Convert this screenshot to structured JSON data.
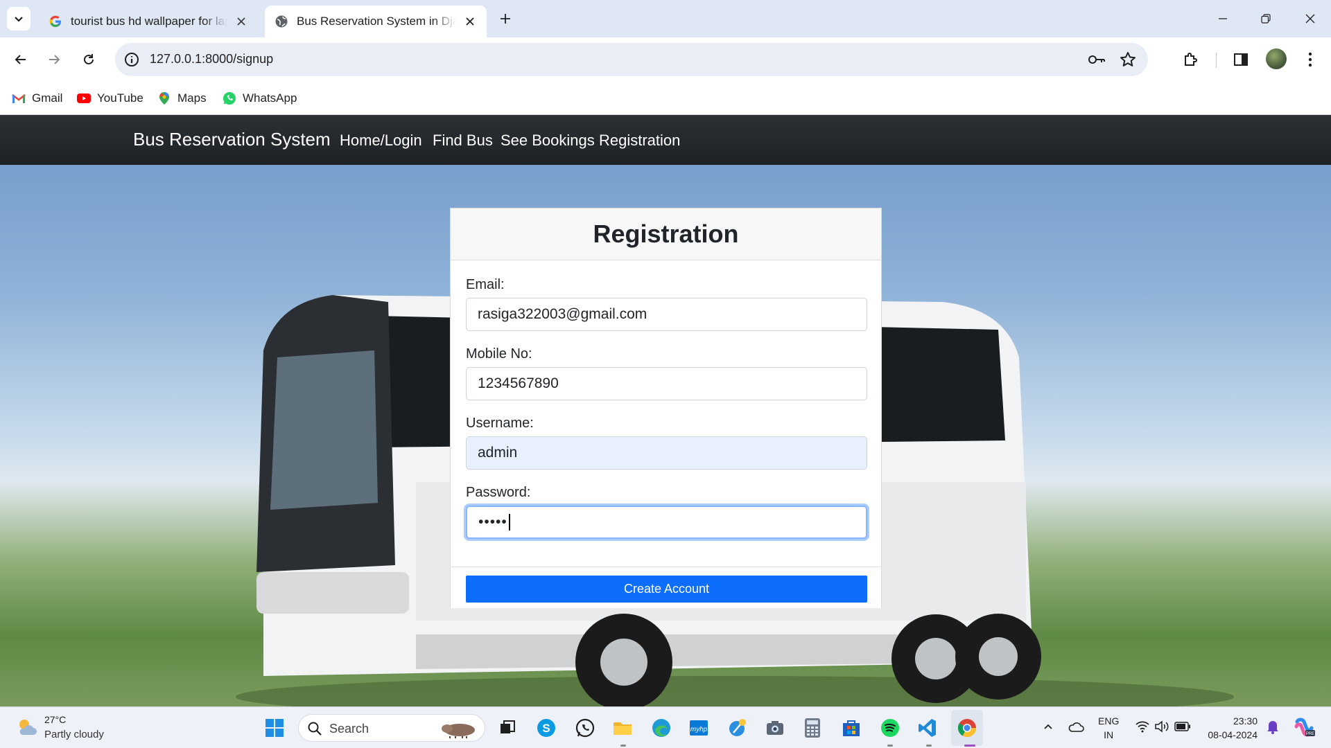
{
  "browser": {
    "tabs": [
      {
        "title": "tourist bus hd wallpaper for lap",
        "active": false
      },
      {
        "title": "Bus Reservation System in Djan",
        "active": true
      }
    ],
    "url": "127.0.0.1:8000/signup",
    "bookmarks": [
      "Gmail",
      "YouTube",
      "Maps",
      "WhatsApp"
    ]
  },
  "site": {
    "brand": "Bus Reservation System",
    "nav": [
      "Home/Login",
      "Find Bus",
      "See Bookings",
      "Registration"
    ]
  },
  "form": {
    "title": "Registration",
    "email_label": "Email:",
    "email_value": "rasiga322003@gmail.com",
    "mobile_label": "Mobile No:",
    "mobile_value": "1234567890",
    "username_label": "Username:",
    "username_value": "admin",
    "password_label": "Password:",
    "password_value": "•••••",
    "submit_label": "Create Account",
    "accent_color": "#0d6efd"
  },
  "taskbar": {
    "weather_temp": "27°C",
    "weather_desc": "Partly cloudy",
    "search_placeholder": "Search",
    "lang_line1": "ENG",
    "lang_line2": "IN",
    "time": "23:30",
    "date": "08-04-2024"
  }
}
